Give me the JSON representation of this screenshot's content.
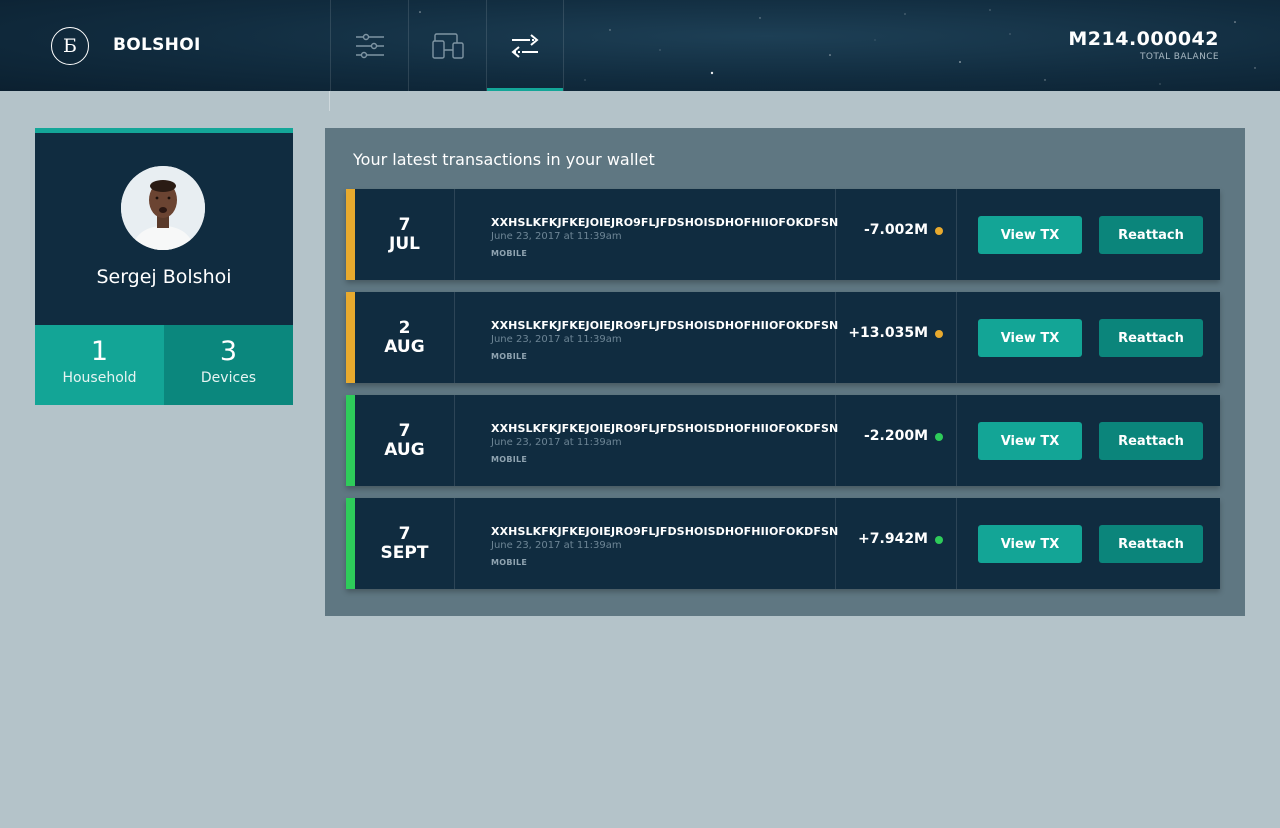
{
  "header": {
    "logo_glyph": "Б",
    "brand": "BOLSHOI",
    "tabs": [
      {
        "icon": "sliders-icon"
      },
      {
        "icon": "devices-icon"
      },
      {
        "icon": "transfer-arrows-icon",
        "active": true
      }
    ],
    "balance": "M214.000042",
    "balance_label": "TOTAL BALANCE"
  },
  "profile": {
    "name": "Sergej Bolshoi",
    "stats": [
      {
        "value": "1",
        "label": "Household"
      },
      {
        "value": "3",
        "label": "Devices"
      }
    ]
  },
  "transactions": {
    "title": "Your latest transactions in your wallet",
    "view_label": "View TX",
    "reattach_label": "Reattach",
    "items": [
      {
        "day": "7",
        "month": "JUL",
        "hash": "XXHSLKFKJFKEJOIEJRO9FLJFDSHOISDHOFHIIOFOKDFSN",
        "time": "June 23, 2017 at 11:39am",
        "source": "MOBILE",
        "amount": "-7.002M",
        "status_color": "#e8aa2e"
      },
      {
        "day": "2",
        "month": "AUG",
        "hash": "XXHSLKFKJFKEJOIEJRO9FLJFDSHOISDHOFHIIOFOKDFSN",
        "time": "June 23, 2017 at 11:39am",
        "source": "MOBILE",
        "amount": "+13.035M",
        "status_color": "#e8aa2e"
      },
      {
        "day": "7",
        "month": "AUG",
        "hash": "XXHSLKFKJFKEJOIEJRO9FLJFDSHOISDHOFHIIOFOKDFSN",
        "time": "June 23, 2017 at 11:39am",
        "source": "MOBILE",
        "amount": "-2.200M",
        "status_color": "#2ecc5a"
      },
      {
        "day": "7",
        "month": "SEPT",
        "hash": "XXHSLKFKJFKEJOIEJRO9FLJFDSHOISDHOFHIIOFOKDFSN",
        "time": "June 23, 2017 at 11:39am",
        "source": "MOBILE",
        "amount": "+7.942M",
        "status_color": "#2ecc5a"
      }
    ]
  },
  "colors": {
    "accent": "#14a698",
    "pending": "#e8aa2e",
    "confirmed": "#2ecc5a",
    "dark_panel": "#102c40"
  }
}
